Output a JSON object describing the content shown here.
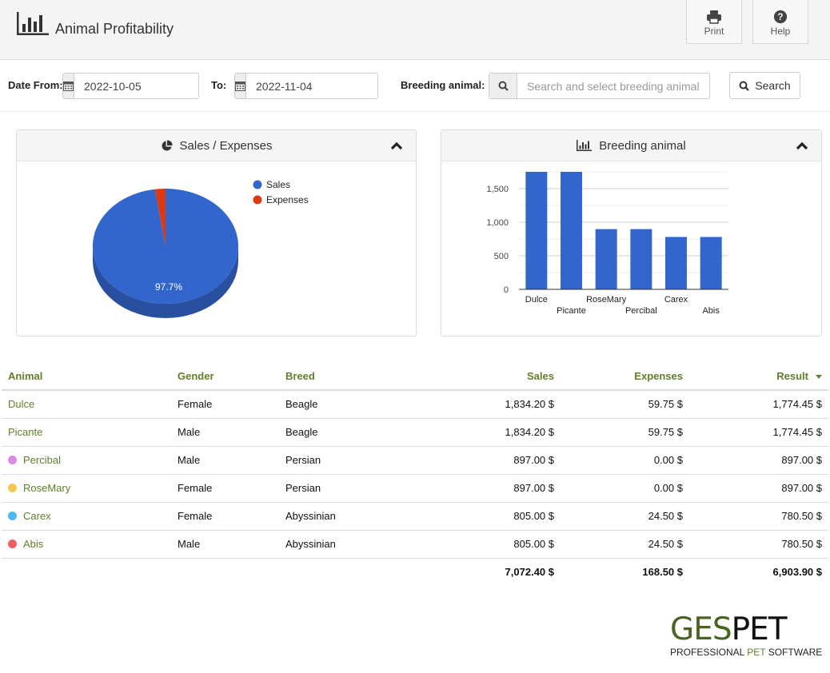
{
  "header": {
    "title": "Animal Profitability",
    "logo_icon": "bar-chart-icon",
    "buttons": {
      "print": {
        "label": "Print",
        "icon": "printer-icon"
      },
      "help": {
        "label": "Help",
        "icon": "question-circle-icon"
      }
    }
  },
  "filters": {
    "date_from_label": "Date From:",
    "date_from_value": "2022-10-05",
    "date_to_label": "To:",
    "date_to_value": "2022-11-04",
    "breeding_label": "Breeding animal:",
    "breeding_placeholder": "Search and select breeding animal",
    "breeding_value": "",
    "search_label": "Search",
    "calendar_icon": "calendar-icon",
    "search_icon": "search-icon"
  },
  "panels": {
    "sales_expenses": {
      "title": "Sales / Expenses",
      "icon": "pie-chart-icon",
      "collapse_icon": "chevron-up-icon"
    },
    "breeding_animal": {
      "title": "Breeding animal",
      "icon": "bar-chart-icon",
      "collapse_icon": "chevron-up-icon"
    }
  },
  "chart_data": [
    {
      "type": "pie",
      "title": "Sales / Expenses",
      "categories": [
        "Sales",
        "Expenses"
      ],
      "values": [
        7072.4,
        168.5
      ],
      "colors": [
        "#3366cc",
        "#dc3912"
      ],
      "data_labels": [
        "97.7%",
        ""
      ],
      "legend": "right",
      "style": "3d"
    },
    {
      "type": "bar",
      "title": "Breeding animal",
      "categories": [
        "Dulce",
        "Picante",
        "RoseMary",
        "Percibal",
        "Carex",
        "Abis"
      ],
      "values": [
        1774.45,
        1774.45,
        897.0,
        897.0,
        780.5,
        780.5
      ],
      "color": "#3366cc",
      "ylim": [
        0,
        1750
      ],
      "yticks": [
        0,
        500,
        1000,
        1500
      ],
      "ytick_labels": [
        "0",
        "500",
        "1,000",
        "1,500"
      ],
      "minor_gridlines": [
        250,
        750,
        1250,
        1750
      ],
      "grid": true,
      "xlabel": "",
      "ylabel": ""
    }
  ],
  "table": {
    "columns": [
      "Animal",
      "Gender",
      "Breed",
      "Sales",
      "Expenses",
      "Result"
    ],
    "sorted_column": "Result",
    "rows": [
      {
        "animal": "Dulce",
        "dot": null,
        "gender": "Female",
        "breed": "Beagle",
        "sales": "1,834.20 $",
        "expenses": "59.75 $",
        "result": "1,774.45 $"
      },
      {
        "animal": "Picante",
        "dot": null,
        "gender": "Male",
        "breed": "Beagle",
        "sales": "1,834.20 $",
        "expenses": "59.75 $",
        "result": "1,774.45 $"
      },
      {
        "animal": "Percibal",
        "dot": "#d98be0",
        "gender": "Male",
        "breed": "Persian",
        "sales": "897.00 $",
        "expenses": "0.00 $",
        "result": "897.00 $"
      },
      {
        "animal": "RoseMary",
        "dot": "#f2c94c",
        "gender": "Female",
        "breed": "Persian",
        "sales": "897.00 $",
        "expenses": "0.00 $",
        "result": "897.00 $"
      },
      {
        "animal": "Carex",
        "dot": "#4db8f0",
        "gender": "Female",
        "breed": "Abyssinian",
        "sales": "805.00 $",
        "expenses": "24.50 $",
        "result": "780.50 $"
      },
      {
        "animal": "Abis",
        "dot": "#f06060",
        "gender": "Male",
        "breed": "Abyssinian",
        "sales": "805.00 $",
        "expenses": "24.50 $",
        "result": "780.50 $"
      }
    ],
    "totals": {
      "sales": "7,072.40 $",
      "expenses": "168.50 $",
      "result": "6,903.90 $"
    }
  },
  "brand": {
    "name_part1": "GES",
    "name_part2": "PET",
    "tagline_part1": "PROFESSIONAL ",
    "tagline_part2": "PET",
    "tagline_part3": " SOFTWARE"
  },
  "colors": {
    "accent_green": "#5f7f2a",
    "brand_green": "#4a6321",
    "chart_blue": "#3366cc",
    "chart_red": "#dc3912"
  }
}
